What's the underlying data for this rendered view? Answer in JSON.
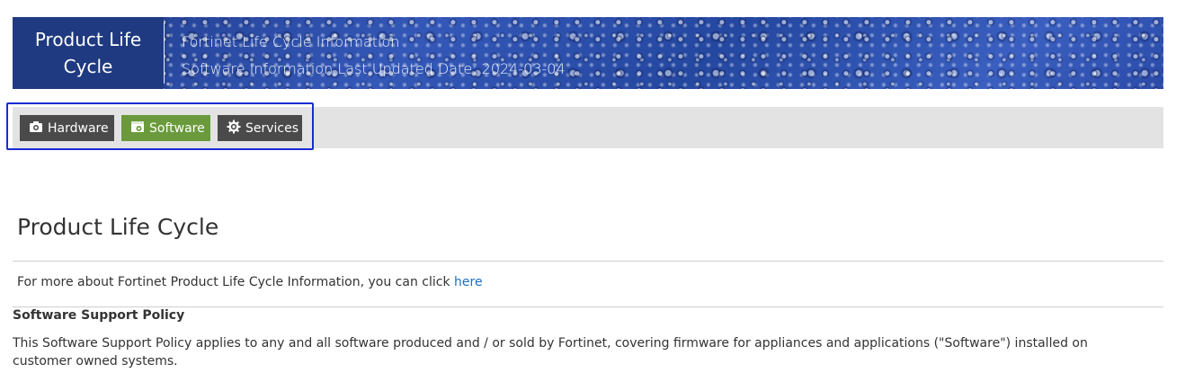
{
  "banner": {
    "title": "Product Life Cycle",
    "info_line1": "Fortinet Life Cycle Information",
    "info_line2": "Software Information Last Updated Date: 2024-03-04"
  },
  "tabs": [
    {
      "label": "Hardware",
      "icon": "camera-icon",
      "color": "#4a4a4a",
      "active": false
    },
    {
      "label": "Software",
      "icon": "software-package-icon",
      "color": "#6a9a3c",
      "active": true
    },
    {
      "label": "Services",
      "icon": "gear-icon",
      "color": "#4a4a4a",
      "active": false
    }
  ],
  "main": {
    "title": "Product Life Cycle",
    "more_info_text": "For more about Fortinet Product Life Cycle Information, you can click ",
    "more_info_link": "here",
    "policy_heading": "Software Support Policy",
    "policy_text": "This Software Support Policy applies to any and all software produced and / or sold by Fortinet, covering firmware for appliances and applications (\"Software\") installed on customer owned systems."
  },
  "colors": {
    "link": "#1a6fc4",
    "focus_outline": "#1a2bd6",
    "banner_blue": "#2d4fa6"
  }
}
